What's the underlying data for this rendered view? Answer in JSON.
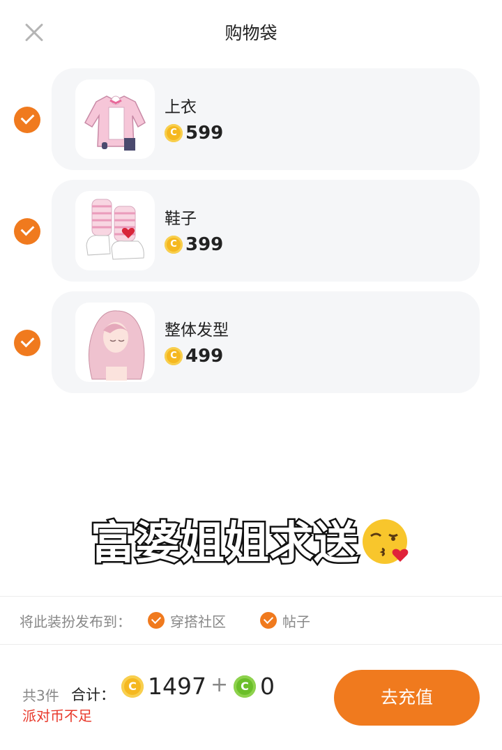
{
  "header": {
    "title": "购物袋"
  },
  "items": [
    {
      "name": "上衣",
      "price": "599",
      "checked": true,
      "icon": "jacket-image"
    },
    {
      "name": "鞋子",
      "price": "399",
      "checked": true,
      "icon": "shoes-image"
    },
    {
      "name": "整体发型",
      "price": "499",
      "checked": true,
      "icon": "hairstyle-image"
    }
  ],
  "caption": {
    "text": "富婆姐姐求送",
    "emoji": "kissing-face-emoji"
  },
  "publish": {
    "label": "将此装扮发布到：",
    "options": [
      {
        "label": "穿搭社区",
        "checked": true
      },
      {
        "label": "帖子",
        "checked": true
      }
    ]
  },
  "footer": {
    "count_label": "共3件",
    "total_label": "合计：",
    "gold_total": "1497",
    "plus": "+",
    "green_total": "0",
    "warning": "派对币不足",
    "cta_label": "去充值"
  },
  "colors": {
    "accent": "#f07a1e",
    "warning": "#e8392b",
    "gold_coin": "#f5b820",
    "green_coin": "#6bbf2a"
  }
}
